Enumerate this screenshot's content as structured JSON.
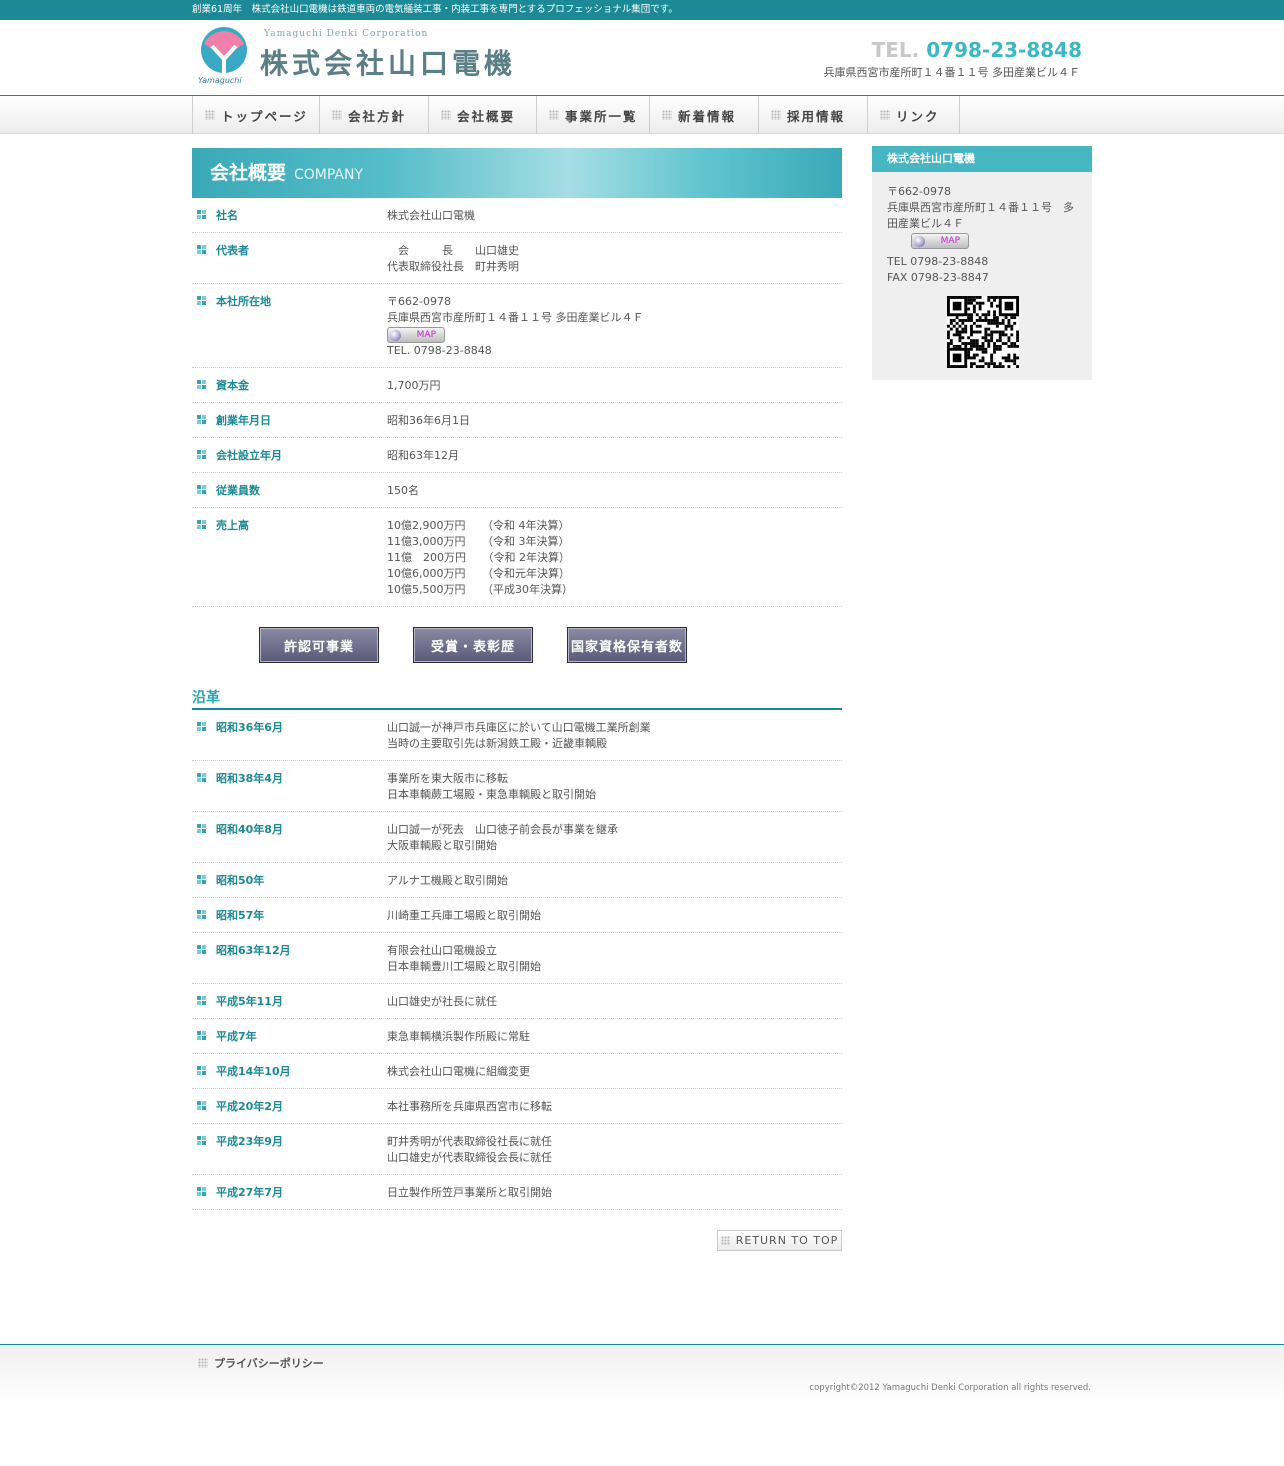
{
  "top_strip": {
    "text": "創業61周年　株式会社山口電機は鉄道車両の電気艤装工事・内装工事を専門とするプロフェッショナル集団です。"
  },
  "header": {
    "logo_sub": "Yamaguchi Denki Corporation",
    "logo_name": "株式会社山口電機",
    "logo_brand": "Yamaguchi",
    "tel_label": "TEL.",
    "tel_number": "0798-23-8848",
    "address": "兵庫県西宮市産所町１４番１１号 多田産業ビル４Ｆ"
  },
  "nav": [
    {
      "label": "トップページ"
    },
    {
      "label": "会社方針"
    },
    {
      "label": "会社概要"
    },
    {
      "label": "事業所一覧"
    },
    {
      "label": "新着情報"
    },
    {
      "label": "採用情報"
    },
    {
      "label": "リンク"
    }
  ],
  "page": {
    "title": "会社概要",
    "title_en": "COMPANY"
  },
  "overview": {
    "name": {
      "label": "社名",
      "value": "株式会社山口電機"
    },
    "rep": {
      "label": "代表者",
      "line1": "　会　　　長　　山口雄史",
      "line2": "代表取締役社長　町井秀明"
    },
    "hq": {
      "label": "本社所在地",
      "zip": "〒662-0978",
      "addr": "兵庫県西宮市産所町１４番１１号 多田産業ビル４Ｆ",
      "map": "MAP",
      "tel": "TEL. 0798-23-8848"
    },
    "capital": {
      "label": "資本金",
      "value": "1,700万円"
    },
    "founded": {
      "label": "創業年月日",
      "value": "昭和36年6月1日"
    },
    "established": {
      "label": "会社設立年月",
      "value": "昭和63年12月"
    },
    "employees": {
      "label": "従業員数",
      "value": "150名"
    },
    "sales": {
      "label": "売上高",
      "lines": [
        "10億2,900万円　　（令和 4年決算）",
        "11億3,000万円　　（令和 3年決算）",
        "11億　200万円　　（令和 2年決算）",
        "10億6,000万円　　（令和元年決算）",
        "10億5,500万円　　（平成30年決算）"
      ]
    }
  },
  "buttons": [
    {
      "label": "許認可事業"
    },
    {
      "label": "受賞・表彰歴"
    },
    {
      "label": "国家資格保有者数"
    }
  ],
  "history_title": "沿革",
  "history": [
    {
      "date": "昭和36年6月",
      "line1": "山口誠一が神戸市兵庫区に於いて山口電機工業所創業",
      "line2": "当時の主要取引先は新潟鉄工殿・近畿車輌殿"
    },
    {
      "date": "昭和38年4月",
      "line1": "事業所を東大阪市に移転",
      "line2": "日本車輌蕨工場殿・東急車輌殿と取引開始"
    },
    {
      "date": "昭和40年8月",
      "line1": "山口誠一が死去　山口徳子前会長が事業を継承",
      "line2": "大阪車輌殿と取引開始"
    },
    {
      "date": "昭和50年",
      "line1": "アルナ工機殿と取引開始",
      "line2": ""
    },
    {
      "date": "昭和57年",
      "line1": "川崎重工兵庫工場殿と取引開始",
      "line2": ""
    },
    {
      "date": "昭和63年12月",
      "line1": "有限会社山口電機設立",
      "line2": "日本車輌豊川工場殿と取引開始"
    },
    {
      "date": "平成5年11月",
      "line1": "山口雄史が社長に就任",
      "line2": ""
    },
    {
      "date": "平成7年",
      "line1": "東急車輌横浜製作所殿に常駐",
      "line2": ""
    },
    {
      "date": "平成14年10月",
      "line1": "株式会社山口電機に組織変更",
      "line2": ""
    },
    {
      "date": "平成20年2月",
      "line1": "本社事務所を兵庫県西宮市に移転",
      "line2": ""
    },
    {
      "date": "平成23年9月",
      "line1": "町井秀明が代表取締役社長に就任",
      "line2": "山口雄史が代表取締役会長に就任"
    },
    {
      "date": "平成27年7月",
      "line1": "日立製作所笠戸事業所と取引開始",
      "line2": ""
    }
  ],
  "return_top": "RETURN TO TOP",
  "sidebar": {
    "title": "株式会社山口電機",
    "zip": "〒662-0978",
    "addr1": "兵庫県西宮市産所町１４番１１号　多",
    "addr2": "田産業ビル４Ｆ",
    "map": "MAP",
    "tel": "TEL 0798-23-8848",
    "fax": "FAX 0798-23-8847"
  },
  "footer": {
    "privacy": "プライバシーポリシー",
    "copyright": "copyright©2012 Yamaguchi Denki Corporation all rights reserved."
  },
  "colors": {
    "teal": "#1b8a96",
    "accent": "#46b6c3",
    "logo_pink": "#f080a8"
  }
}
